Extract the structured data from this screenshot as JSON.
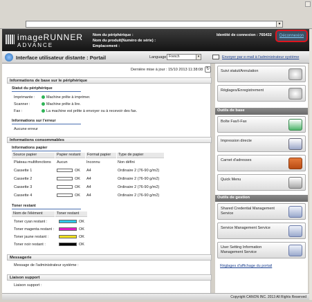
{
  "browser": {
    "url_value": ""
  },
  "header": {
    "brand_main": "imageRUNNER",
    "brand_sub": "ADVANCE",
    "device_name_label": "Nom du périphérique :",
    "product_name_label": "Nom du produit(Numéro de série) :",
    "location_label": "Emplacement :",
    "login_label": "Identité de connexion : 765432",
    "logout_label": "Déconnexion"
  },
  "titlebar": {
    "title": "Interface utilisateur distante : Portail",
    "language_label": "Language:",
    "language_value": "French",
    "email_link": "Envoyer par e-mail à l'administrateur système"
  },
  "main": {
    "last_update": "Dernière mise à jour : 15/10 2013 11:38:08",
    "basic_info_title": "Informations de base sur le périphérique",
    "status_title": "Statut du périphérique",
    "status": [
      {
        "label": "Imprimante :",
        "text": "Machine prête à imprimer."
      },
      {
        "label": "Scanner :",
        "text": "Machine prête à lire."
      },
      {
        "label": "Fax :",
        "text": "La machine est prête à envoyer ou à recevoir des fax."
      }
    ],
    "error_title": "Informations sur l'erreur",
    "error_text": "Aucune erreur",
    "consumables_title": "Informations consommables",
    "paper_title": "Informations papier",
    "paper_headers": [
      "Source papier",
      "Papier restant",
      "Format papier",
      "Type de papier"
    ],
    "paper_rows": [
      {
        "source": "Plateau multifonctions",
        "remaining": "Aucun",
        "size": "Inconnu",
        "type": "Non défini"
      },
      {
        "source": "Cassette 1",
        "remaining": "OK",
        "size": "A4",
        "type": "Ordinaire 2 (76-90 g/m2)"
      },
      {
        "source": "Cassette 2",
        "remaining": "OK",
        "size": "A4",
        "type": "Ordinaire 2 (76-90 g/m2)"
      },
      {
        "source": "Cassette 3",
        "remaining": "OK",
        "size": "A4",
        "type": "Ordinaire 2 (76-90 g/m2)"
      },
      {
        "source": "Cassette 4",
        "remaining": "OK",
        "size": "A4",
        "type": "Ordinaire 2 (76-90 g/m2)"
      }
    ],
    "toner_title": "Toner restant",
    "toner_headers": [
      "Nom de l'élément",
      "Toner restant"
    ],
    "toner_rows": [
      {
        "name": "Toner cyan restant :",
        "status": "OK",
        "color": "#2ec8e8"
      },
      {
        "name": "Toner magenta restant :",
        "status": "OK",
        "color": "#e020c8"
      },
      {
        "name": "Toner jaune restant :",
        "status": "OK",
        "color": "#f0e020"
      },
      {
        "name": "Toner noir restant :",
        "status": "OK",
        "color": "#000000"
      }
    ],
    "message_title": "Messagerie",
    "message_text": "Message de l'administrateur système :",
    "support_title": "Liaison support",
    "support_text": "Liaison support :"
  },
  "right": {
    "top_buttons": [
      "Suivi statut/Annulation",
      "Réglages/Enregistrement"
    ],
    "basic_tools_title": "Outils de base",
    "basic_tools": [
      "Boîte Fax/I-Fax",
      "Impression directe",
      "Carnet d'adresses",
      "Quick Menu"
    ],
    "management_title": "Outils de gestion",
    "management_tools": [
      "Shared Credential Management Service",
      "Service Management Service",
      "User Setting Information Management Service"
    ],
    "portal_settings_link": "Réglages d'affichage du portail"
  },
  "footer": {
    "copyright": "Copyright CANON INC. 2013 All Rights Reserved"
  }
}
